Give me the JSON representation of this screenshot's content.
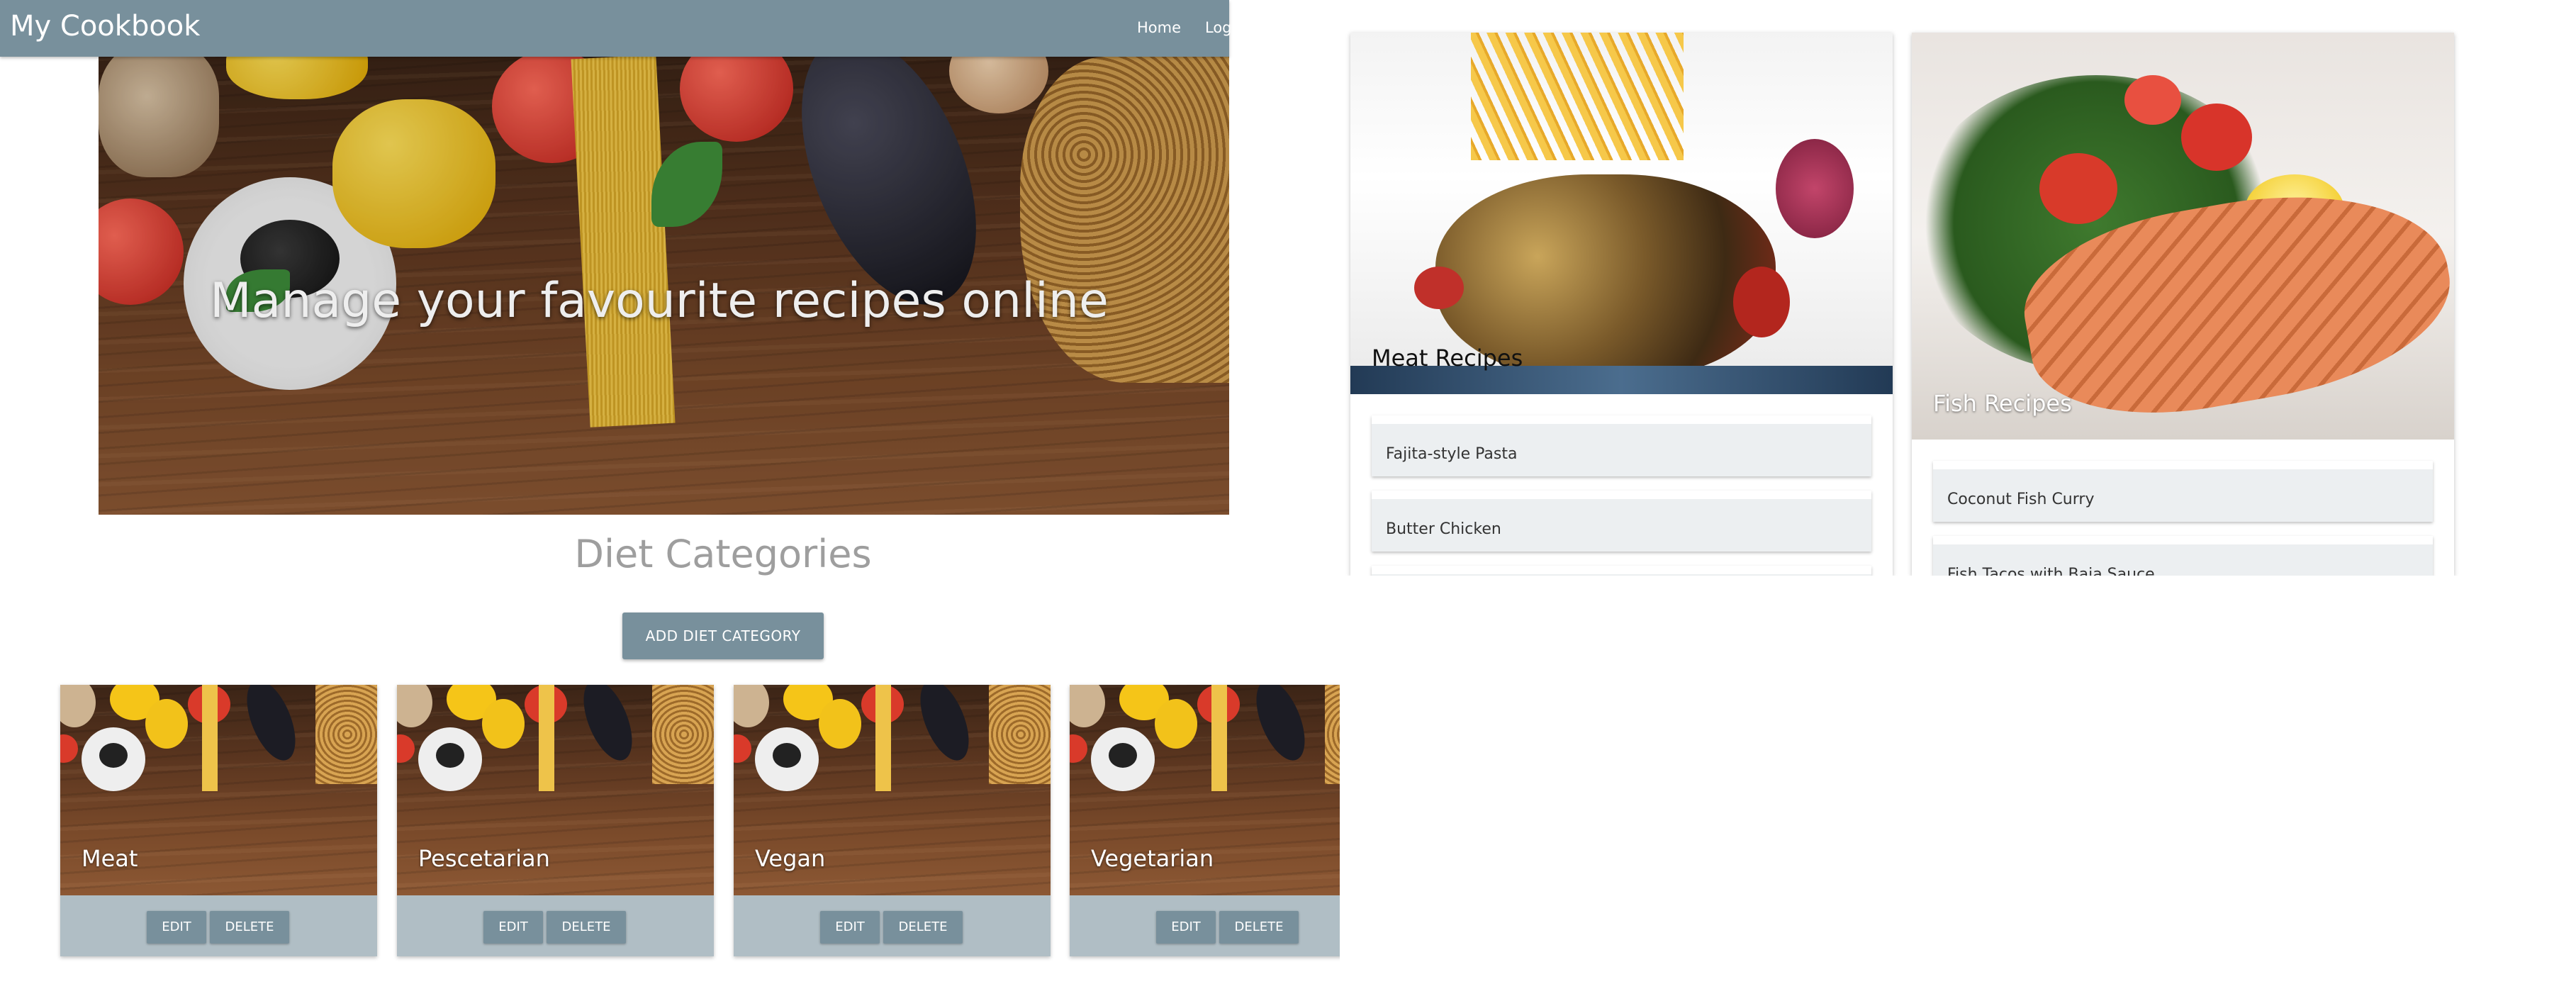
{
  "navbar": {
    "brand": "My Cookbook",
    "links": [
      "Home",
      "Log"
    ]
  },
  "hero": {
    "title": "Manage your favourite recipes online"
  },
  "diet": {
    "heading": "Diet Categories",
    "add_button": "ADD DIET CATEGORY",
    "categories": [
      {
        "name": "Meat",
        "edit": "EDIT",
        "delete": "DELETE"
      },
      {
        "name": "Pescetarian",
        "edit": "EDIT",
        "delete": "DELETE"
      },
      {
        "name": "Vegan",
        "edit": "EDIT",
        "delete": "DELETE"
      },
      {
        "name": "Vegetarian",
        "edit": "EDIT",
        "delete": "DELETE"
      }
    ]
  },
  "recipes": {
    "cards": [
      {
        "title": "Meat Recipes",
        "items": [
          "Fajita-style Pasta",
          "Butter Chicken"
        ]
      },
      {
        "title": "Fish Recipes",
        "items": [
          "Coconut Fish Curry",
          "Fish Tacos with Baja Sauce"
        ]
      }
    ]
  },
  "colors": {
    "navbar": "#78909c",
    "card_footer": "#b0bec5",
    "list_item": "#eceff1",
    "heading": "#9e9e9e"
  }
}
